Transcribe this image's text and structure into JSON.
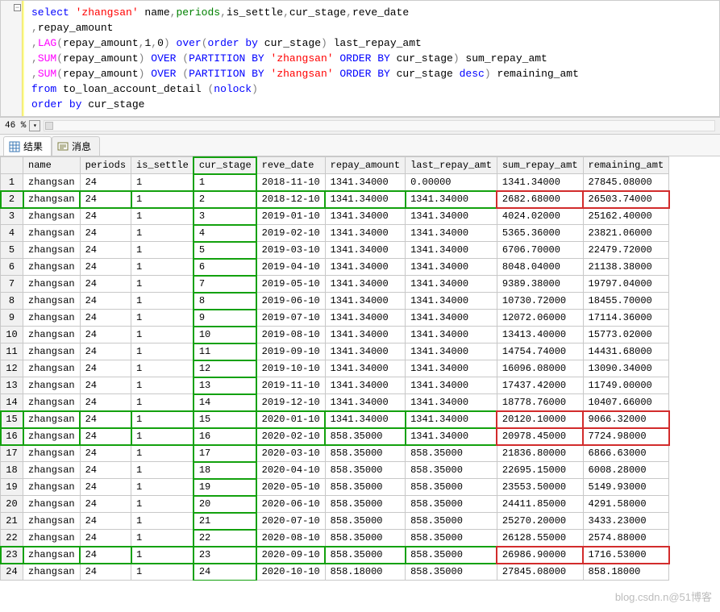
{
  "code": {
    "l1": {
      "a": "select ",
      "b": "'zhangsan'",
      "c": " name",
      "d": ",",
      "e": "periods",
      "f": ",",
      "g": "is_settle",
      "h": ",",
      "i": "cur_stage",
      "j": ",",
      "k": "reve_date"
    },
    "l2": {
      "a": ",",
      "b": "repay_amount"
    },
    "l3": {
      "a": ",",
      "b": "LAG",
      "c": "(",
      "d": "repay_amount",
      "e": ",",
      "f": "1",
      "g": ",",
      "h": "0",
      "i": ") ",
      "j": "over",
      "k": "(",
      "l": "order",
      "m": " ",
      "n": "by",
      "o": " cur_stage",
      "p": ")",
      "q": " last_repay_amt"
    },
    "l4": {
      "a": ",",
      "b": "SUM",
      "c": "(",
      "d": "repay_amount",
      "e": ") ",
      "f": "OVER ",
      "g": "(",
      "h": "PARTITION",
      "i": " ",
      "j": "BY ",
      "k": "'zhangsan'",
      "l": " ",
      "m": "ORDER",
      "n": " ",
      "o": "BY",
      "p": " cur_stage",
      "q": ")",
      "r": " sum_repay_amt"
    },
    "l5": {
      "a": ",",
      "b": "SUM",
      "c": "(",
      "d": "repay_amount",
      "e": ") ",
      "f": "OVER ",
      "g": "(",
      "h": "PARTITION",
      "i": " ",
      "j": "BY ",
      "k": "'zhangsan'",
      "l": " ",
      "m": "ORDER",
      "n": " ",
      "o": "BY",
      "p": " cur_stage ",
      "q": "desc",
      "r": ")",
      "s": " remaining_amt"
    },
    "l6": {
      "a": "from",
      "b": " to_loan_account_detail ",
      "c": "(",
      "d": "nolock",
      "e": ")"
    },
    "l7": {
      "a": "order",
      "b": " ",
      "c": "by",
      "d": " cur_stage"
    }
  },
  "zoom": {
    "label": "46 %",
    "caret": "▾"
  },
  "tabs": {
    "results": "结果",
    "messages": "消息"
  },
  "columns": [
    "",
    "name",
    "periods",
    "is_settle",
    "cur_stage",
    "reve_date",
    "repay_amount",
    "last_repay_amt",
    "sum_repay_amt",
    "remaining_amt"
  ],
  "rows": [
    {
      "n": "1",
      "name": "zhangsan",
      "periods": "24",
      "is_settle": "1",
      "cur_stage": "1",
      "reve_date": "2018-11-10",
      "repay_amount": "1341.34000",
      "last_repay_amt": "0.00000",
      "sum_repay_amt": "1341.34000",
      "remaining_amt": "27845.08000"
    },
    {
      "n": "2",
      "name": "zhangsan",
      "periods": "24",
      "is_settle": "1",
      "cur_stage": "2",
      "reve_date": "2018-12-10",
      "repay_amount": "1341.34000",
      "last_repay_amt": "1341.34000",
      "sum_repay_amt": "2682.68000",
      "remaining_amt": "26503.74000"
    },
    {
      "n": "3",
      "name": "zhangsan",
      "periods": "24",
      "is_settle": "1",
      "cur_stage": "3",
      "reve_date": "2019-01-10",
      "repay_amount": "1341.34000",
      "last_repay_amt": "1341.34000",
      "sum_repay_amt": "4024.02000",
      "remaining_amt": "25162.40000"
    },
    {
      "n": "4",
      "name": "zhangsan",
      "periods": "24",
      "is_settle": "1",
      "cur_stage": "4",
      "reve_date": "2019-02-10",
      "repay_amount": "1341.34000",
      "last_repay_amt": "1341.34000",
      "sum_repay_amt": "5365.36000",
      "remaining_amt": "23821.06000"
    },
    {
      "n": "5",
      "name": "zhangsan",
      "periods": "24",
      "is_settle": "1",
      "cur_stage": "5",
      "reve_date": "2019-03-10",
      "repay_amount": "1341.34000",
      "last_repay_amt": "1341.34000",
      "sum_repay_amt": "6706.70000",
      "remaining_amt": "22479.72000"
    },
    {
      "n": "6",
      "name": "zhangsan",
      "periods": "24",
      "is_settle": "1",
      "cur_stage": "6",
      "reve_date": "2019-04-10",
      "repay_amount": "1341.34000",
      "last_repay_amt": "1341.34000",
      "sum_repay_amt": "8048.04000",
      "remaining_amt": "21138.38000"
    },
    {
      "n": "7",
      "name": "zhangsan",
      "periods": "24",
      "is_settle": "1",
      "cur_stage": "7",
      "reve_date": "2019-05-10",
      "repay_amount": "1341.34000",
      "last_repay_amt": "1341.34000",
      "sum_repay_amt": "9389.38000",
      "remaining_amt": "19797.04000"
    },
    {
      "n": "8",
      "name": "zhangsan",
      "periods": "24",
      "is_settle": "1",
      "cur_stage": "8",
      "reve_date": "2019-06-10",
      "repay_amount": "1341.34000",
      "last_repay_amt": "1341.34000",
      "sum_repay_amt": "10730.72000",
      "remaining_amt": "18455.70000"
    },
    {
      "n": "9",
      "name": "zhangsan",
      "periods": "24",
      "is_settle": "1",
      "cur_stage": "9",
      "reve_date": "2019-07-10",
      "repay_amount": "1341.34000",
      "last_repay_amt": "1341.34000",
      "sum_repay_amt": "12072.06000",
      "remaining_amt": "17114.36000"
    },
    {
      "n": "10",
      "name": "zhangsan",
      "periods": "24",
      "is_settle": "1",
      "cur_stage": "10",
      "reve_date": "2019-08-10",
      "repay_amount": "1341.34000",
      "last_repay_amt": "1341.34000",
      "sum_repay_amt": "13413.40000",
      "remaining_amt": "15773.02000"
    },
    {
      "n": "11",
      "name": "zhangsan",
      "periods": "24",
      "is_settle": "1",
      "cur_stage": "11",
      "reve_date": "2019-09-10",
      "repay_amount": "1341.34000",
      "last_repay_amt": "1341.34000",
      "sum_repay_amt": "14754.74000",
      "remaining_amt": "14431.68000"
    },
    {
      "n": "12",
      "name": "zhangsan",
      "periods": "24",
      "is_settle": "1",
      "cur_stage": "12",
      "reve_date": "2019-10-10",
      "repay_amount": "1341.34000",
      "last_repay_amt": "1341.34000",
      "sum_repay_amt": "16096.08000",
      "remaining_amt": "13090.34000"
    },
    {
      "n": "13",
      "name": "zhangsan",
      "periods": "24",
      "is_settle": "1",
      "cur_stage": "13",
      "reve_date": "2019-11-10",
      "repay_amount": "1341.34000",
      "last_repay_amt": "1341.34000",
      "sum_repay_amt": "17437.42000",
      "remaining_amt": "11749.00000"
    },
    {
      "n": "14",
      "name": "zhangsan",
      "periods": "24",
      "is_settle": "1",
      "cur_stage": "14",
      "reve_date": "2019-12-10",
      "repay_amount": "1341.34000",
      "last_repay_amt": "1341.34000",
      "sum_repay_amt": "18778.76000",
      "remaining_amt": "10407.66000"
    },
    {
      "n": "15",
      "name": "zhangsan",
      "periods": "24",
      "is_settle": "1",
      "cur_stage": "15",
      "reve_date": "2020-01-10",
      "repay_amount": "1341.34000",
      "last_repay_amt": "1341.34000",
      "sum_repay_amt": "20120.10000",
      "remaining_amt": "9066.32000"
    },
    {
      "n": "16",
      "name": "zhangsan",
      "periods": "24",
      "is_settle": "1",
      "cur_stage": "16",
      "reve_date": "2020-02-10",
      "repay_amount": "858.35000",
      "last_repay_amt": "1341.34000",
      "sum_repay_amt": "20978.45000",
      "remaining_amt": "7724.98000"
    },
    {
      "n": "17",
      "name": "zhangsan",
      "periods": "24",
      "is_settle": "1",
      "cur_stage": "17",
      "reve_date": "2020-03-10",
      "repay_amount": "858.35000",
      "last_repay_amt": "858.35000",
      "sum_repay_amt": "21836.80000",
      "remaining_amt": "6866.63000"
    },
    {
      "n": "18",
      "name": "zhangsan",
      "periods": "24",
      "is_settle": "1",
      "cur_stage": "18",
      "reve_date": "2020-04-10",
      "repay_amount": "858.35000",
      "last_repay_amt": "858.35000",
      "sum_repay_amt": "22695.15000",
      "remaining_amt": "6008.28000"
    },
    {
      "n": "19",
      "name": "zhangsan",
      "periods": "24",
      "is_settle": "1",
      "cur_stage": "19",
      "reve_date": "2020-05-10",
      "repay_amount": "858.35000",
      "last_repay_amt": "858.35000",
      "sum_repay_amt": "23553.50000",
      "remaining_amt": "5149.93000"
    },
    {
      "n": "20",
      "name": "zhangsan",
      "periods": "24",
      "is_settle": "1",
      "cur_stage": "20",
      "reve_date": "2020-06-10",
      "repay_amount": "858.35000",
      "last_repay_amt": "858.35000",
      "sum_repay_amt": "24411.85000",
      "remaining_amt": "4291.58000"
    },
    {
      "n": "21",
      "name": "zhangsan",
      "periods": "24",
      "is_settle": "1",
      "cur_stage": "21",
      "reve_date": "2020-07-10",
      "repay_amount": "858.35000",
      "last_repay_amt": "858.35000",
      "sum_repay_amt": "25270.20000",
      "remaining_amt": "3433.23000"
    },
    {
      "n": "22",
      "name": "zhangsan",
      "periods": "24",
      "is_settle": "1",
      "cur_stage": "22",
      "reve_date": "2020-08-10",
      "repay_amount": "858.35000",
      "last_repay_amt": "858.35000",
      "sum_repay_amt": "26128.55000",
      "remaining_amt": "2574.88000"
    },
    {
      "n": "23",
      "name": "zhangsan",
      "periods": "24",
      "is_settle": "1",
      "cur_stage": "23",
      "reve_date": "2020-09-10",
      "repay_amount": "858.35000",
      "last_repay_amt": "858.35000",
      "sum_repay_amt": "26986.90000",
      "remaining_amt": "1716.53000"
    },
    {
      "n": "24",
      "name": "zhangsan",
      "periods": "24",
      "is_settle": "1",
      "cur_stage": "24",
      "reve_date": "2020-10-10",
      "repay_amount": "858.18000",
      "last_repay_amt": "858.35000",
      "sum_repay_amt": "27845.08000",
      "remaining_amt": "858.18000"
    }
  ],
  "watermark_a": "blog.csdn.n",
  "watermark_b": "@51博客",
  "highlights": {
    "greenRows": [
      2,
      15,
      16,
      23
    ],
    "redRows": {
      "2": [
        "sum_repay_amt",
        "remaining_amt"
      ],
      "15": [
        "sum_repay_amt",
        "remaining_amt"
      ],
      "16": [
        "sum_repay_amt",
        "remaining_amt"
      ],
      "23": [
        "sum_repay_amt",
        "remaining_amt"
      ]
    },
    "greenColCurStage": true
  }
}
